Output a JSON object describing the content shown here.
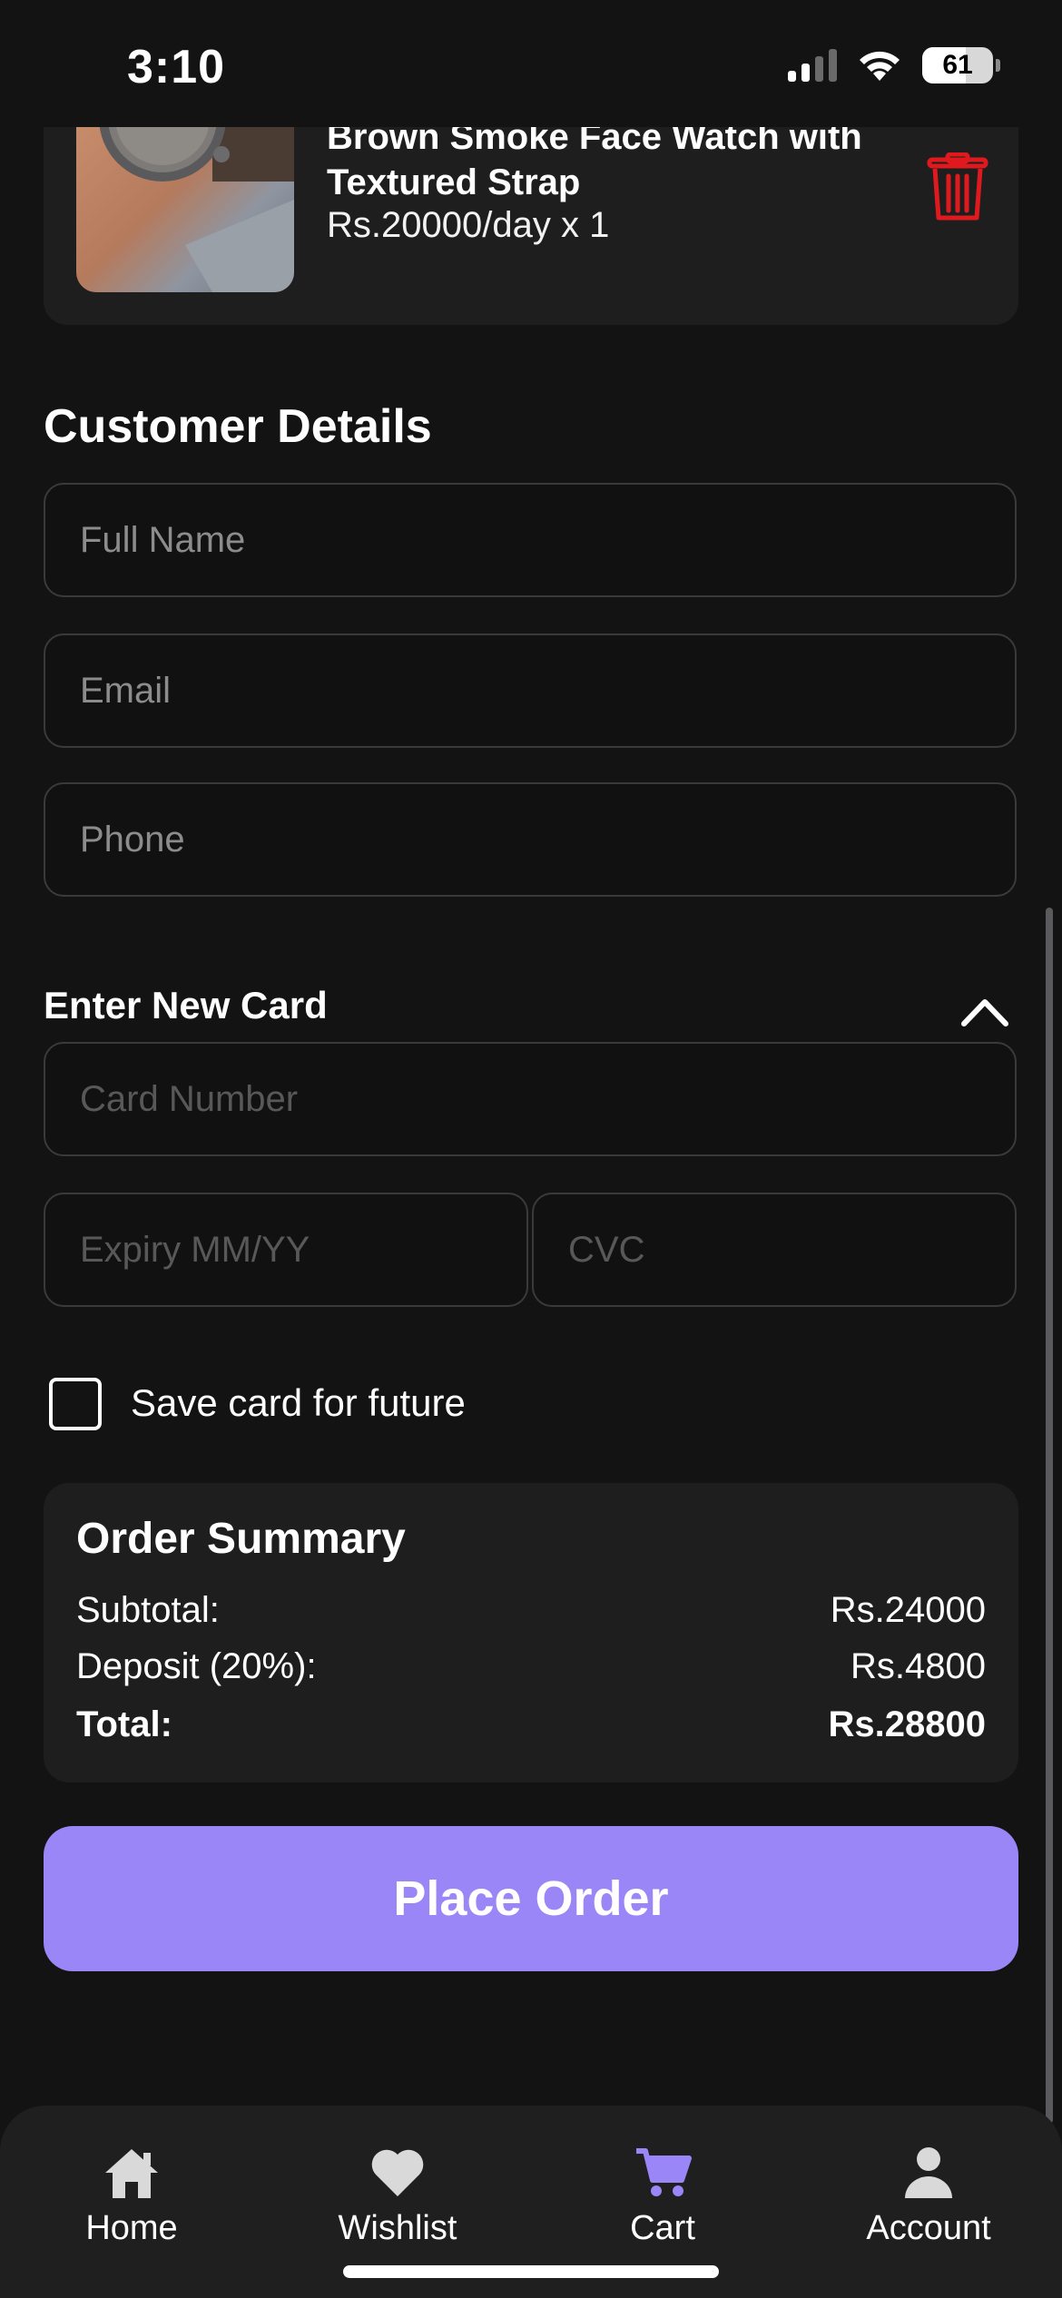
{
  "status_bar": {
    "time": "3:10",
    "battery": "61",
    "battery_level": 0.61
  },
  "cart_item": {
    "name": "Brown Smoke Face Watch with Textured Strap",
    "price": "Rs.20000/day x 1",
    "delete_icon": "trash-icon",
    "delete_color": "#e0191e"
  },
  "customer_details": {
    "title": "Customer Details",
    "full_name_placeholder": "Full Name",
    "email_placeholder": "Email",
    "phone_placeholder": "Phone"
  },
  "card": {
    "header": "Enter New Card",
    "toggle_icon": "chevron-up-icon",
    "number_placeholder": "Card Number",
    "expiry_placeholder": "Expiry MM/YY",
    "cvc_placeholder": "CVC",
    "save_label": "Save card for future"
  },
  "order_summary": {
    "title": "Order Summary",
    "subtotal_label": "Subtotal:",
    "subtotal_value": "Rs.24000",
    "deposit_label": "Deposit (20%):",
    "deposit_value": "Rs.4800",
    "total_label": "Total:",
    "total_value": "Rs.28800"
  },
  "place_order_label": "Place Order",
  "accent_color": "#9a86f6",
  "tabs": [
    {
      "label": "Home",
      "icon": "home-icon",
      "active": false
    },
    {
      "label": "Wishlist",
      "icon": "heart-icon",
      "active": false
    },
    {
      "label": "Cart",
      "icon": "cart-icon",
      "active": true
    },
    {
      "label": "Account",
      "icon": "user-icon",
      "active": false
    }
  ]
}
